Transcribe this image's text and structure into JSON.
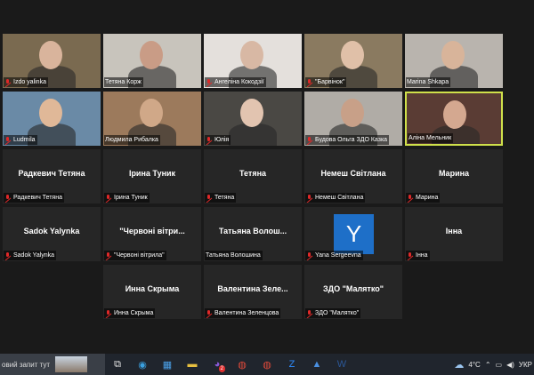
{
  "tiles": [
    {
      "name": "Izdo yalinka",
      "muted": true,
      "video": true,
      "bg": "#7a6a50",
      "skin": "#d9b49c"
    },
    {
      "name": "Тетяна Корж",
      "muted": false,
      "video": true,
      "bg": "#c8c4bc",
      "skin": "#c99c86"
    },
    {
      "name": "Ангеліна Кокодзії",
      "muted": true,
      "video": true,
      "bg": "#e4e0dc",
      "skin": "#d8b8a4"
    },
    {
      "name": "\"Барвінок\"",
      "muted": true,
      "video": true,
      "bg": "#8a7a60",
      "skin": "#e0c0a8"
    },
    {
      "name": "Marina Shkapa",
      "muted": false,
      "video": true,
      "bg": "#b9b4ae",
      "skin": "#d8b49a"
    },
    {
      "name": "Ludmila",
      "muted": true,
      "video": true,
      "bg": "#6a8aa6",
      "skin": "#e0b898"
    },
    {
      "name": "Людмила Рибалка",
      "muted": false,
      "video": true,
      "bg": "#9c7a5c",
      "skin": "#d0a888"
    },
    {
      "name": "Юлія",
      "muted": true,
      "video": true,
      "bg": "#4a4844",
      "skin": "#e2c4b0"
    },
    {
      "name": "Будова Ольга ЗДО Казка",
      "muted": true,
      "video": true,
      "bg": "#b0aca6",
      "skin": "#c8a088"
    },
    {
      "name": "Аліна Мельник",
      "muted": false,
      "video": true,
      "bg": "#5a3c34",
      "skin": "#d4a890",
      "active": true
    },
    {
      "name": "Радкевич Тетяна",
      "center": "Радкевич Тетяна",
      "muted": true
    },
    {
      "name": "Ірина Туник",
      "center": "Ірина Туник",
      "muted": true
    },
    {
      "name": "Тетяна",
      "center": "Тетяна",
      "muted": true
    },
    {
      "name": "Немеш Світлана",
      "center": "Немеш Світлана",
      "muted": true
    },
    {
      "name": "Марина",
      "center": "Марина",
      "muted": true
    },
    {
      "name": "Sadok Yalynka",
      "center": "Sadok Yalynka",
      "muted": true
    },
    {
      "name": "\"Червоні вітрила\"",
      "center": "\"Червоні вітри...",
      "muted": true
    },
    {
      "name": "Татьяна Волошина",
      "center": "Татьяна Волош...",
      "muted": false
    },
    {
      "name": "Yana Sergeevna",
      "avatar_letter": "Y",
      "muted": true
    },
    {
      "name": "Інна",
      "center": "Інна",
      "muted": true
    },
    {
      "name": "Инна Скрыма",
      "center": "Инна Скрыма",
      "muted": true
    },
    {
      "name": "Валентина Зеленцова",
      "center": "Валентина Зеле...",
      "muted": true
    },
    {
      "name": "ЗДО \"Малятко\"",
      "center": "ЗДО \"Малятко\"",
      "muted": true
    }
  ],
  "taskbar": {
    "search_text": "овий запит тут",
    "icons": [
      "task-view-icon",
      "edge-icon",
      "store-icon",
      "file-explorer-icon",
      "viber-icon",
      "chrome-icon",
      "chrome-icon",
      "zoom-icon",
      "app-icon",
      "word-icon"
    ],
    "icon_glyphs": [
      "⧉",
      "◉",
      "▦",
      "▬",
      "◕",
      "◍",
      "◍",
      "Z",
      "▲",
      "W"
    ],
    "icon_colors": [
      "#e8e8e8",
      "#3aa0e0",
      "#4aa0e8",
      "#e8c040",
      "#8a5ad8",
      "#e04a3a",
      "#e04a3a",
      "#2d8cff",
      "#4a90e2",
      "#2b5797"
    ],
    "badge": "2",
    "temperature": "4°C",
    "language": "УКР"
  }
}
